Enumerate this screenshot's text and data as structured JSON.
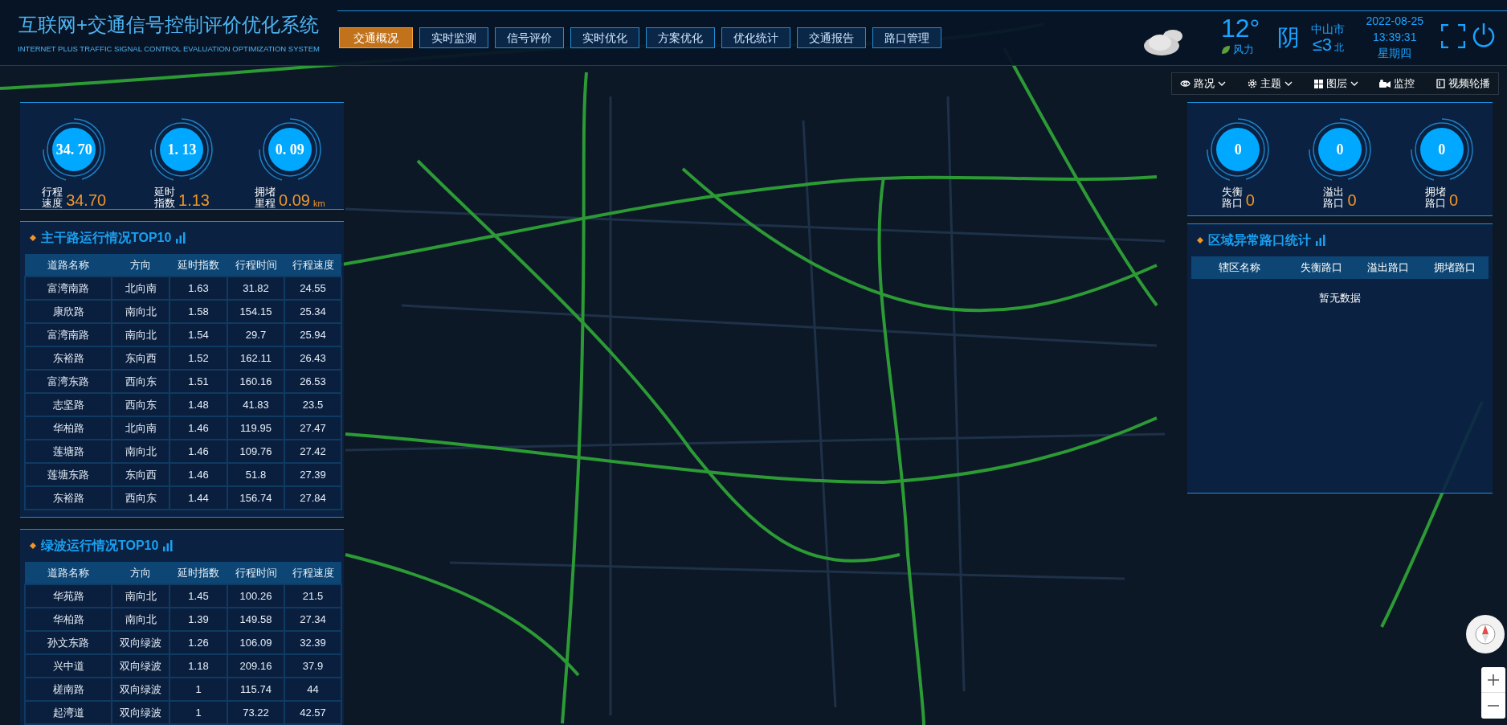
{
  "header": {
    "title": "互联网+交通信号控制评价优化系统",
    "subtitle": "INTERNET PLUS TRAFFIC SIGNAL CONTROL EVALUATION OPTIMIZATION SYSTEM"
  },
  "nav_tabs": [
    {
      "label": "交通概况",
      "selected": true
    },
    {
      "label": "实时监测",
      "selected": false
    },
    {
      "label": "信号评价",
      "selected": false
    },
    {
      "label": "实时优化",
      "selected": false
    },
    {
      "label": "方案优化",
      "selected": false
    },
    {
      "label": "优化统计",
      "selected": false
    },
    {
      "label": "交通报告",
      "selected": false
    },
    {
      "label": "路口管理",
      "selected": false
    }
  ],
  "weather": {
    "temperature": "12°",
    "wind_label": "风力",
    "condition": "阴",
    "city": "中山市",
    "wind_level": "≤3",
    "wind_direction": "北"
  },
  "datetime": {
    "date": "2022-08-25",
    "time": "13:39:31",
    "weekday": "星期四"
  },
  "map_toolbar": [
    {
      "label": "路况",
      "dropdown": true
    },
    {
      "label": "主题",
      "dropdown": true
    },
    {
      "label": "图层",
      "dropdown": true
    },
    {
      "label": "监控",
      "dropdown": false
    },
    {
      "label": "视频轮播",
      "dropdown": false
    }
  ],
  "traffic_kpis": [
    {
      "circle_value": "34. 70",
      "label": "行程速度",
      "value": "34.70"
    },
    {
      "circle_value": "1. 13",
      "label": "延时指数",
      "value": "1.13"
    },
    {
      "circle_value": "0. 09",
      "label": "拥堵里程",
      "value": "0.09",
      "unit": "km"
    }
  ],
  "arterial_top10": {
    "title": "主干路运行情况TOP10",
    "columns": [
      "道路名称",
      "方向",
      "延时指数",
      "行程时间",
      "行程速度"
    ],
    "rows": [
      [
        "富湾南路",
        "北向南",
        "1.63",
        "31.82",
        "24.55"
      ],
      [
        "康欣路",
        "南向北",
        "1.58",
        "154.15",
        "25.34"
      ],
      [
        "富湾南路",
        "南向北",
        "1.54",
        "29.7",
        "25.94"
      ],
      [
        "东裕路",
        "东向西",
        "1.52",
        "162.11",
        "26.43"
      ],
      [
        "富湾东路",
        "西向东",
        "1.51",
        "160.16",
        "26.53"
      ],
      [
        "志坚路",
        "西向东",
        "1.48",
        "41.83",
        "23.5"
      ],
      [
        "华柏路",
        "北向南",
        "1.46",
        "119.95",
        "27.47"
      ],
      [
        "莲塘路",
        "南向北",
        "1.46",
        "109.76",
        "27.42"
      ],
      [
        "莲塘东路",
        "东向西",
        "1.46",
        "51.8",
        "27.39"
      ],
      [
        "东裕路",
        "西向东",
        "1.44",
        "156.74",
        "27.84"
      ]
    ]
  },
  "green_wave_top10": {
    "title": "绿波运行情况TOP10",
    "columns": [
      "道路名称",
      "方向",
      "延时指数",
      "行程时间",
      "行程速度"
    ],
    "rows": [
      [
        "华苑路",
        "南向北",
        "1.45",
        "100.26",
        "21.5"
      ],
      [
        "华柏路",
        "南向北",
        "1.39",
        "149.58",
        "27.34"
      ],
      [
        "孙文东路",
        "双向绿波",
        "1.26",
        "106.09",
        "32.39"
      ],
      [
        "兴中道",
        "双向绿波",
        "1.18",
        "209.16",
        "37.9"
      ],
      [
        "槎南路",
        "双向绿波",
        "1",
        "115.74",
        "44"
      ],
      [
        "起湾道",
        "双向绿波",
        "1",
        "73.22",
        "42.57"
      ]
    ]
  },
  "intersection_kpis": [
    {
      "circle_value": "0",
      "label": "失衡路口",
      "value": "0"
    },
    {
      "circle_value": "0",
      "label": "溢出路口",
      "value": "0"
    },
    {
      "circle_value": "0",
      "label": "拥堵路口",
      "value": "0"
    }
  ],
  "region_abnormal": {
    "title": "区域异常路口统计",
    "columns": [
      "辖区名称",
      "失衡路口",
      "溢出路口",
      "拥堵路口"
    ],
    "empty_text": "暂无数据"
  }
}
